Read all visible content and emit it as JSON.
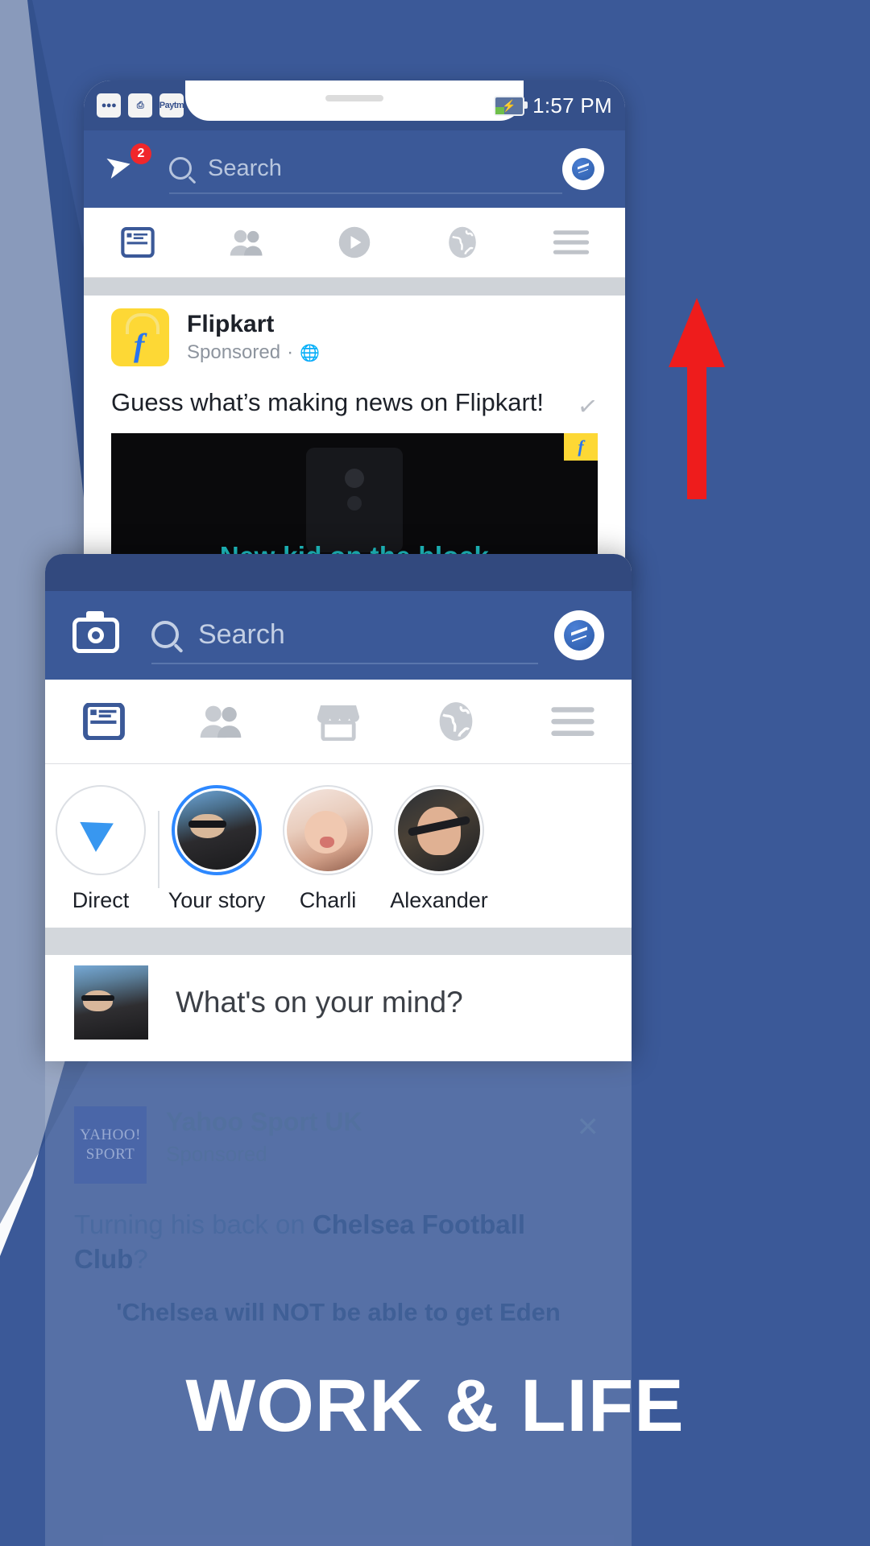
{
  "theme": {
    "fb_blue": "#3b5998",
    "accent_blue": "#2d88ff",
    "badge_red": "#f0272b",
    "arrow_red": "#ee1c1c",
    "flipkart_yellow": "#fdd835"
  },
  "headline": {
    "text": "WORK & LIFE"
  },
  "phone_back": {
    "status_bar": {
      "icons": [
        "more-dots-icon",
        "screen-cast-icon",
        "paytm-icon"
      ],
      "paytm_label": "Paytm",
      "battery": "battery-charging-icon",
      "time": "1:57 PM"
    },
    "top_bar": {
      "rocket_icon": "rocket-icon",
      "notification_count": "2",
      "search_icon": "search-icon",
      "search_placeholder": "Search",
      "messenger_icon": "messenger-icon"
    },
    "tabs": [
      {
        "name": "news-feed",
        "icon": "news-feed-icon",
        "active": true
      },
      {
        "name": "friends",
        "icon": "friends-icon",
        "active": false
      },
      {
        "name": "watch",
        "icon": "play-circle-icon",
        "active": false
      },
      {
        "name": "globe",
        "icon": "globe-icon",
        "active": false
      },
      {
        "name": "menu",
        "icon": "hamburger-menu-icon",
        "active": false
      }
    ],
    "post": {
      "page_name": "Flipkart",
      "sponsored_label": "Sponsored",
      "separator": "·",
      "privacy_icon": "globe-icon",
      "body_text": "Guess what’s making news on Flipkart!",
      "image_caption": "New kid on the block",
      "image_badge": "f"
    }
  },
  "phone_front": {
    "top_bar": {
      "camera_icon": "camera-icon",
      "search_icon": "search-icon",
      "search_placeholder": "Search",
      "messenger_icon": "messenger-icon"
    },
    "tabs": [
      {
        "name": "news-feed",
        "icon": "news-feed-icon",
        "active": true
      },
      {
        "name": "friends",
        "icon": "friends-icon",
        "active": false
      },
      {
        "name": "marketplace",
        "icon": "marketplace-store-icon",
        "active": false
      },
      {
        "name": "globe",
        "icon": "globe-icon",
        "active": false
      },
      {
        "name": "menu",
        "icon": "hamburger-menu-icon",
        "active": false
      }
    ],
    "stories": [
      {
        "label": "Direct",
        "type": "direct",
        "icon": "paper-plane-icon",
        "ring": "plain"
      },
      {
        "label": "Your story",
        "type": "photo",
        "ring": "blue"
      },
      {
        "label": "Charli",
        "type": "photo",
        "ring": "gray"
      },
      {
        "label": "Alexander",
        "type": "photo",
        "ring": "gray"
      }
    ],
    "composer": {
      "avatar": "user-avatar",
      "placeholder": "What's on your mind?"
    }
  },
  "bottom_post": {
    "thumbnail_text": "YAHOO!",
    "thumbnail_sub": "SPORT",
    "page_name": "Yahoo Sport UK",
    "sub_text": "Sponsored",
    "close_icon": "close-icon",
    "body_prefix": "Turning his back on ",
    "body_bold": "Chelsea Football Club",
    "body_suffix": "?",
    "body_line2": "'Chelsea will NOT be able to get Eden"
  }
}
